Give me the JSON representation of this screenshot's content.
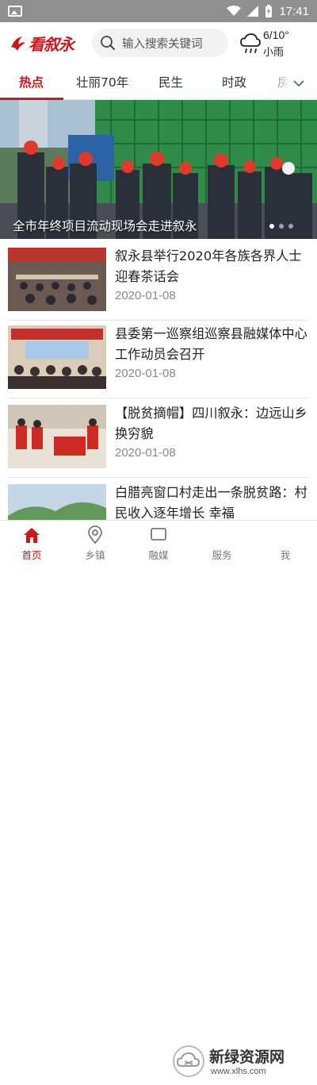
{
  "status_bar": {
    "time": "17:41"
  },
  "header": {
    "logo_text": "看叙永",
    "search": {
      "placeholder": "输入搜索关键词"
    },
    "weather": {
      "temp": "6/10°",
      "desc": "小雨"
    }
  },
  "tabs": [
    {
      "label": "热点",
      "active": true
    },
    {
      "label": "壮丽70年"
    },
    {
      "label": "民生"
    },
    {
      "label": "时政"
    },
    {
      "label": "房"
    }
  ],
  "banner": {
    "caption": "全市年终项目流动现场会走进叙永",
    "slide_count": 3,
    "active_slide": 1
  },
  "news": [
    {
      "title": "叙永县举行2020年各族各界人士迎春茶话会",
      "date": "2020-01-08"
    },
    {
      "title": "县委第一巡察组巡察县融媒体中心工作动员会召开",
      "date": "2020-01-08"
    },
    {
      "title": "【脱贫摘帽】四川叙永：边远山乡换穷貌",
      "date": "2020-01-08"
    },
    {
      "title": "白腊亮窗口村走出一条脱贫路：村民收入逐年增长 幸福",
      "date": ""
    }
  ],
  "bottom_nav": [
    {
      "label": "首页",
      "icon": "home-icon",
      "active": true
    },
    {
      "label": "乡镇",
      "icon": "location-icon"
    },
    {
      "label": "融媒",
      "icon": "media-icon"
    },
    {
      "label": "服务",
      "icon": "service-icon"
    },
    {
      "label": "我",
      "icon": "user-icon"
    }
  ],
  "watermark": {
    "title": "新绿资源网",
    "url": "www.xlhs.com"
  },
  "colors": {
    "accent": "#d0141c",
    "status_bar": "#8f8f8f"
  }
}
